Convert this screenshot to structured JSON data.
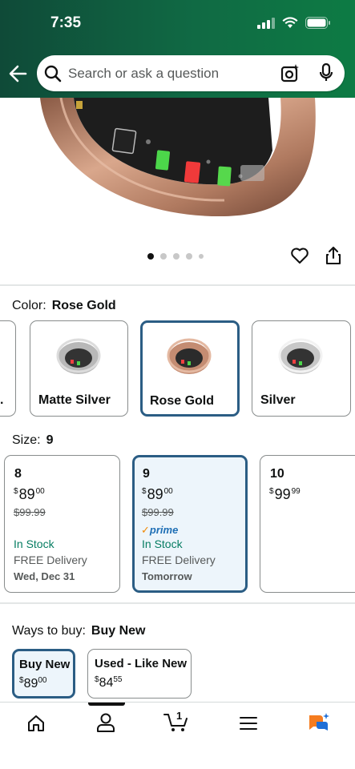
{
  "status_bar": {
    "time": "7:35"
  },
  "search": {
    "placeholder": "Search or ask a question"
  },
  "gallery": {
    "dot_count": 5,
    "active_index": 0
  },
  "color": {
    "label": "Color:",
    "selected": "Rose Gold",
    "options": [
      {
        "name": "Matte Silver"
      },
      {
        "name": "Rose Gold"
      },
      {
        "name": "Silver"
      }
    ]
  },
  "size": {
    "label": "Size:",
    "selected": "9",
    "options": [
      {
        "size": "8",
        "price_whole": "89",
        "price_fraction": "00",
        "currency": "$",
        "list_price": "$99.99",
        "stock": "In Stock",
        "delivery": "FREE Delivery",
        "delivery_date": "Wed, Dec 31",
        "prime": ""
      },
      {
        "size": "9",
        "price_whole": "89",
        "price_fraction": "00",
        "currency": "$",
        "list_price": "$99.99",
        "stock": "In Stock",
        "delivery": "FREE Delivery",
        "delivery_date": "Tomorrow",
        "prime": "prime"
      },
      {
        "size": "10",
        "price_whole": "99",
        "price_fraction": "99",
        "currency": "$"
      }
    ]
  },
  "ways_to_buy": {
    "label": "Ways to buy:",
    "selected": "Buy New",
    "options": [
      {
        "title": "Buy New",
        "currency": "$",
        "price_whole": "89",
        "price_fraction": "00"
      },
      {
        "title": "Used - Like New",
        "currency": "$",
        "price_whole": "84",
        "price_fraction": "55"
      }
    ]
  },
  "bottom_nav": {
    "items": [
      "home-icon",
      "account-icon",
      "cart-icon",
      "menu-icon",
      "rufus-icon"
    ],
    "cart_count": "1"
  },
  "colors": {
    "header_start": "#0f4a38",
    "header_end": "#0d7b44",
    "selected_border": "#2b5d84",
    "in_stock": "#067d62",
    "prime_blue": "#1f6fb5"
  }
}
